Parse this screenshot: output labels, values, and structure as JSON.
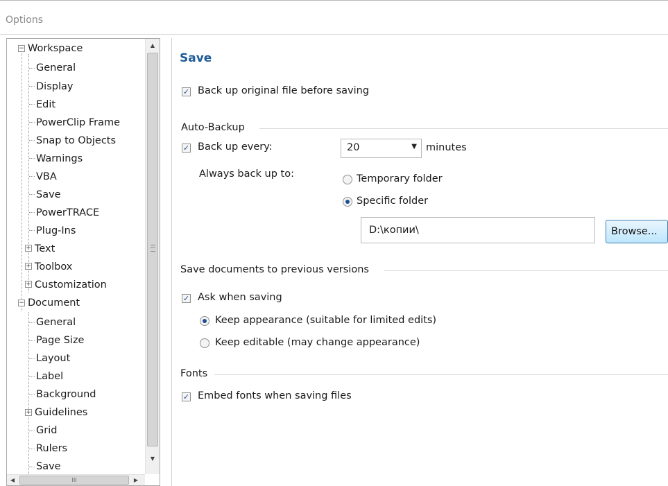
{
  "window": {
    "title": "Options"
  },
  "tree": {
    "workspace": {
      "label": "Workspace",
      "children": [
        "General",
        "Display",
        "Edit",
        "PowerClip Frame",
        "Snap to Objects",
        "Warnings",
        "VBA",
        "Save",
        "PowerTRACE",
        "Plug-Ins"
      ],
      "collapsed": [
        "Text",
        "Toolbox",
        "Customization"
      ]
    },
    "document": {
      "label": "Document",
      "children": [
        "General",
        "Page Size",
        "Layout",
        "Label",
        "Background"
      ],
      "guidelines": "Guidelines",
      "after": [
        "Grid",
        "Rulers",
        "Save"
      ]
    }
  },
  "save": {
    "heading": "Save",
    "backup_original": {
      "label": "Back up original file before saving",
      "checked": true
    },
    "auto_backup": {
      "group_label": "Auto-Backup",
      "every_label": "Back up every:",
      "every_checked": true,
      "interval": "20",
      "unit": "minutes",
      "always_label": "Always back up to:",
      "temp_label": "Temporary folder",
      "specific_label": "Specific folder",
      "selected": "specific",
      "path": "D:\\копии\\",
      "browse_label": "Browse..."
    },
    "previous_versions": {
      "group_label": "Save documents to previous versions",
      "ask_label": "Ask when saving",
      "ask_checked": true,
      "keep_appearance": "Keep appearance (suitable for limited edits)",
      "keep_editable": "Keep editable (may change appearance)",
      "selected": "appearance"
    },
    "fonts": {
      "group_label": "Fonts",
      "embed_label": "Embed fonts when saving files",
      "embed_checked": true
    }
  },
  "scrollbar": {
    "grip": "≡",
    "hgrip": "III"
  },
  "icons": {
    "check": "✓",
    "expand": "+",
    "collapse": "−",
    "up": "▲",
    "down": "▼",
    "left": "◀",
    "right": "▶",
    "caret": "▼"
  }
}
